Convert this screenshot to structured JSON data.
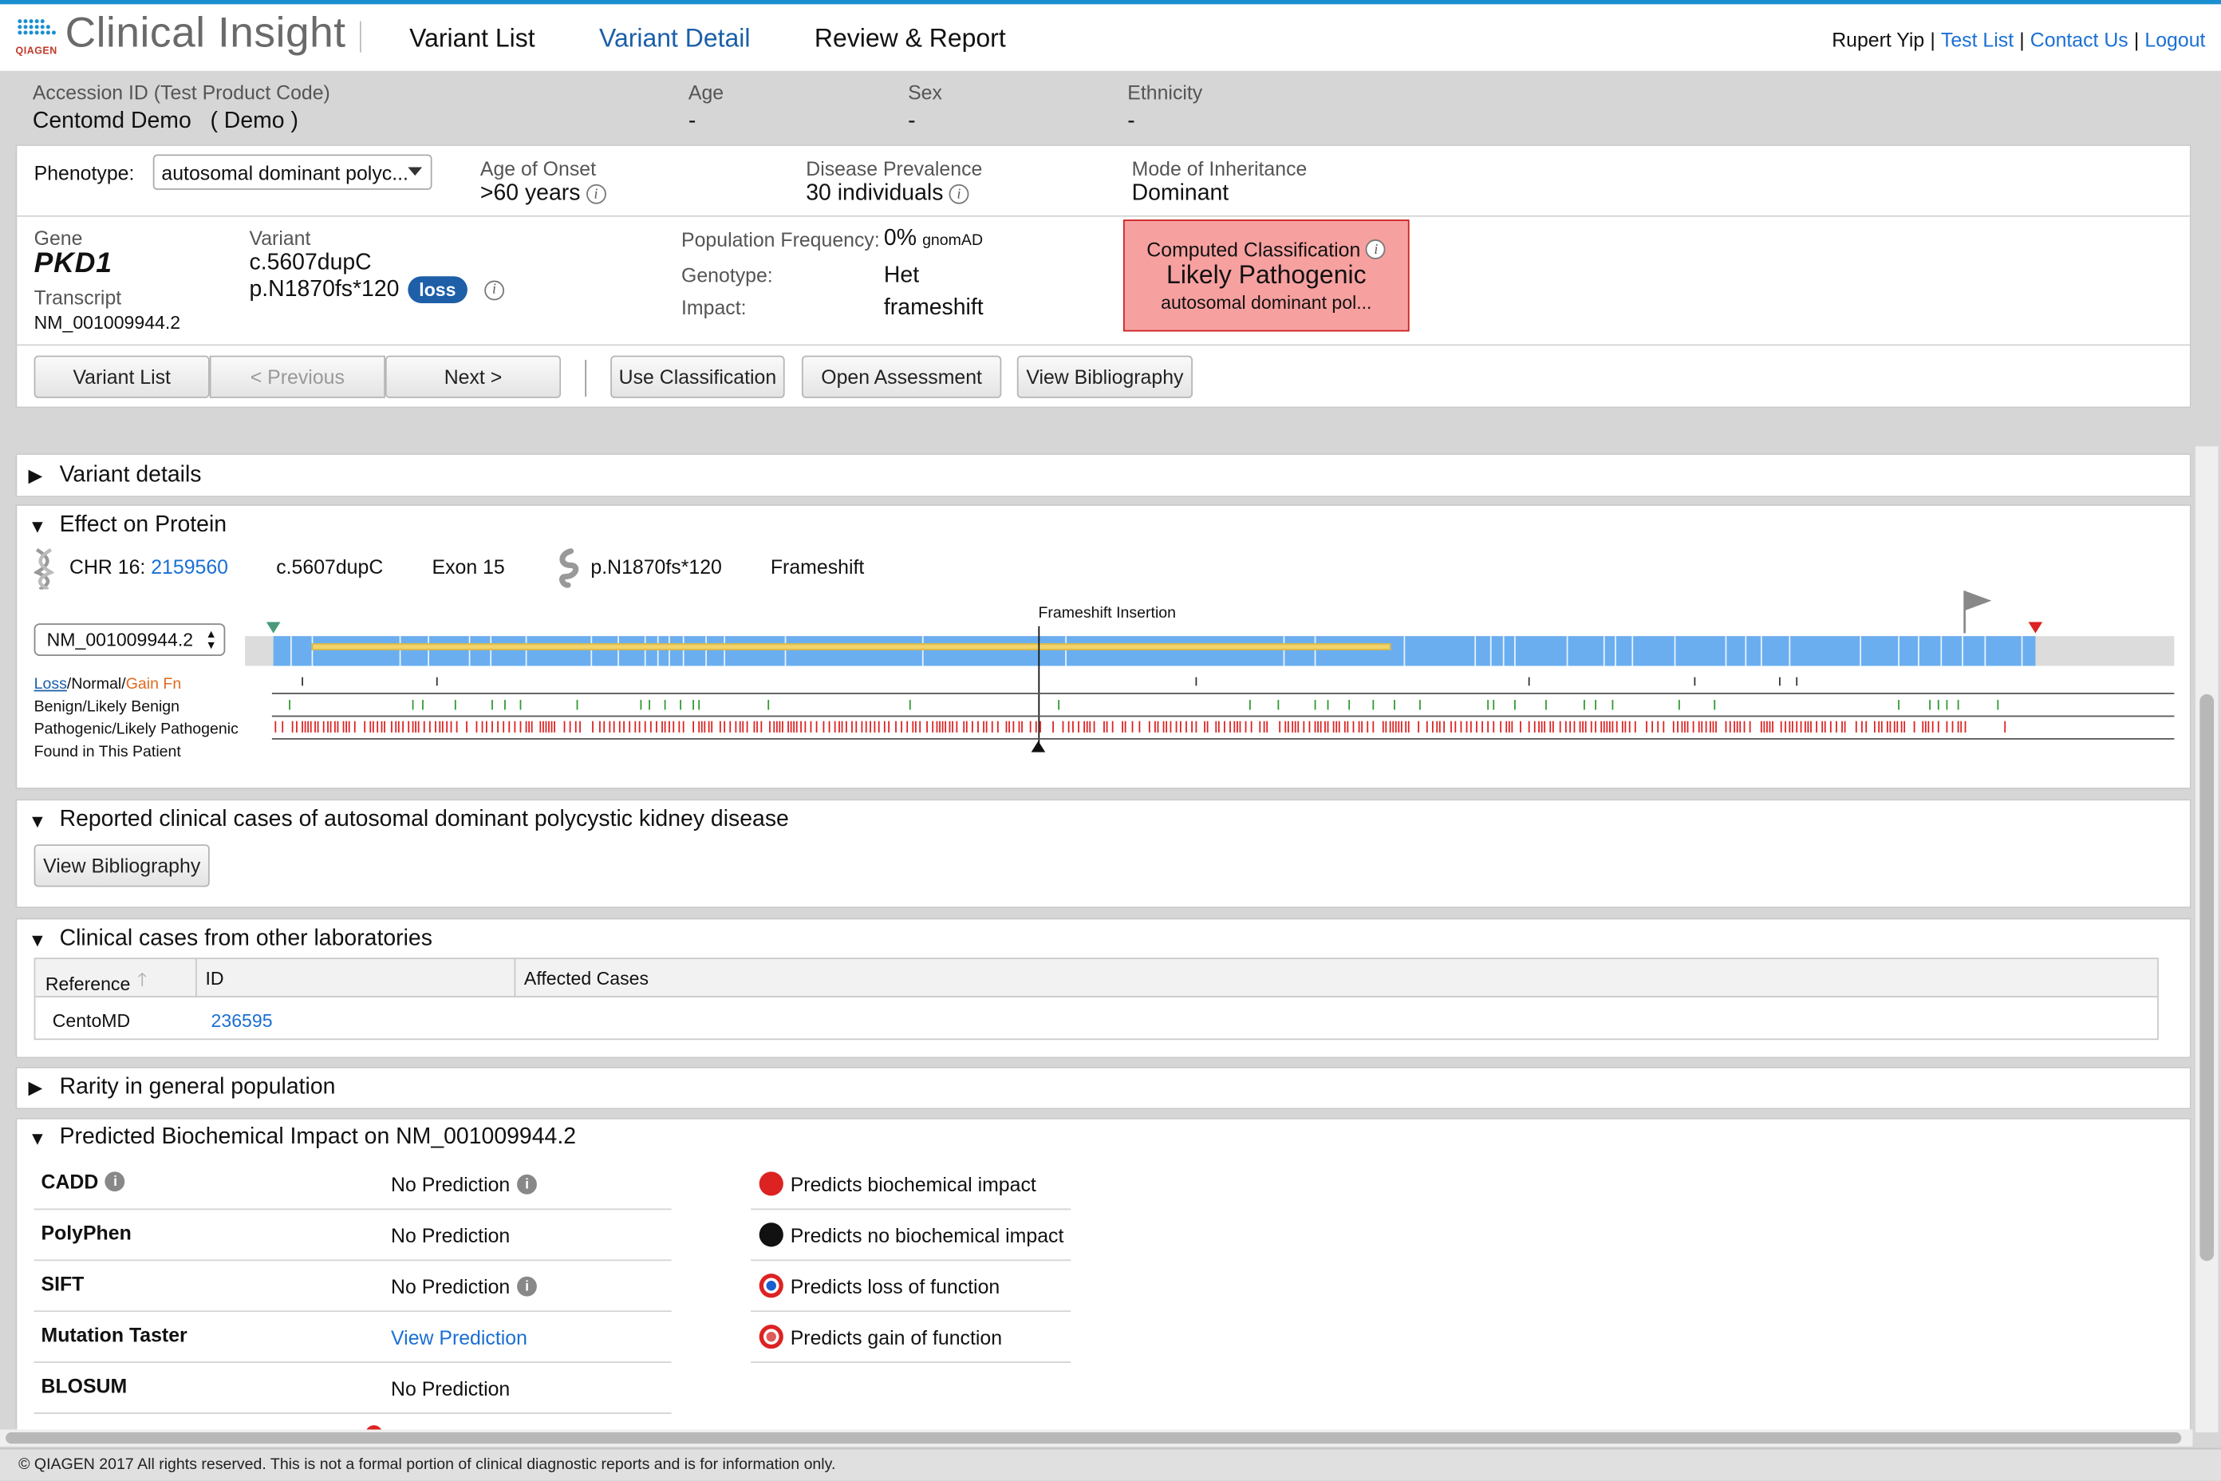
{
  "header": {
    "logo_brand": "QIAGEN",
    "app_title": "Clinical Insight",
    "nav": [
      "Variant List",
      "Variant Detail",
      "Review & Report"
    ],
    "user_name": "Rupert Yip",
    "links": [
      "Test List",
      "Contact Us",
      "Logout"
    ],
    "separator": "|"
  },
  "patient": {
    "accession_label": "Accession ID (Test Product Code)",
    "accession_value": "Centomd Demo   ( Demo )",
    "age_label": "Age",
    "age_value": "-",
    "sex_label": "Sex",
    "sex_value": "-",
    "ethnicity_label": "Ethnicity",
    "ethnicity_value": "-"
  },
  "phenotype": {
    "label": "Phenotype:",
    "selected": "autosomal dominant polyc...",
    "age_onset_label": "Age of Onset",
    "age_onset_value": ">60 years",
    "prevalence_label": "Disease Prevalence",
    "prevalence_value": "30 individuals",
    "inheritance_label": "Mode of Inheritance",
    "inheritance_value": "Dominant"
  },
  "variant": {
    "gene_label": "Gene",
    "gene_value": "PKD1",
    "transcript_label": "Transcript",
    "transcript_value": "NM_001009944.2",
    "variant_label": "Variant",
    "cdna": "c.5607dupC",
    "protein": "p.N1870fs*120",
    "badge": "loss",
    "pop_freq_label": "Population Frequency:",
    "pop_freq_value": "0%",
    "pop_freq_source": "gnomAD",
    "genotype_label": "Genotype:",
    "genotype_value": "Het",
    "impact_label": "Impact:",
    "impact_value": "frameshift",
    "classification_title": "Computed Classification",
    "classification_value": "Likely Pathogenic",
    "classification_sub": "autosomal dominant pol..."
  },
  "actions": {
    "variant_list": "Variant List",
    "previous": "< Previous",
    "next": "Next >",
    "use_classification": "Use Classification",
    "open_assessment": "Open Assessment",
    "view_bibliography": "View Bibliography"
  },
  "sections": {
    "variant_details": "Variant details",
    "effect_on_protein": "Effect on Protein",
    "reported_cases": "Reported clinical cases of autosomal dominant polycystic kidney disease",
    "clinical_cases_other": "Clinical cases from other laboratories",
    "rarity": "Rarity in general population",
    "biochemical": "Predicted Biochemical Impact on NM_001009944.2"
  },
  "effect": {
    "chr_label": "CHR 16:",
    "chr_pos": "2159560",
    "cdna": "c.5607dupC",
    "exon": "Exon 15",
    "protein": "p.N1870fs*120",
    "type": "Frameshift",
    "transcript_select": "NM_001009944.2",
    "marker_label": "Frameshift Insertion",
    "legend_loss": "Loss",
    "legend_normal": "Normal",
    "legend_gain": "Gain Fn",
    "legend_slash": "/",
    "track_benign": "Benign/Likely Benign",
    "track_pathogenic": "Pathogenic/Likely Pathogenic",
    "track_patient": "Found in This Patient"
  },
  "bibliography_button": "View Bibliography",
  "clinical_table": {
    "headers": [
      "Reference",
      "ID",
      "Affected Cases"
    ],
    "rows": [
      {
        "reference": "CentoMD",
        "id": "236595",
        "affected": ""
      }
    ]
  },
  "biochemical": {
    "rows": [
      {
        "name": "CADD",
        "value": "No Prediction"
      },
      {
        "name": "PolyPhen",
        "value": "No Prediction"
      },
      {
        "name": "SIFT",
        "value": "No Prediction"
      },
      {
        "name": "Mutation Taster",
        "value": "View Prediction"
      },
      {
        "name": "BLOSUM",
        "value": "No Prediction"
      }
    ],
    "legend": [
      "Predicts biochemical impact",
      "Predicts no biochemical impact",
      "Predicts loss of function",
      "Predicts gain of function"
    ]
  },
  "footer": "© QIAGEN 2017 All rights reserved. This is not a formal portion of clinical diagnostic reports and is for information only.",
  "colors": {
    "accent_blue": "#1a6fd4",
    "classification_bg": "#f7a0a0",
    "classification_border": "#cc2222",
    "pathogenic_red": "#dd2222",
    "benign_green": "#2e9a2e",
    "protein_blue": "#6aaef0",
    "domain_yellow": "#f2d36b"
  }
}
